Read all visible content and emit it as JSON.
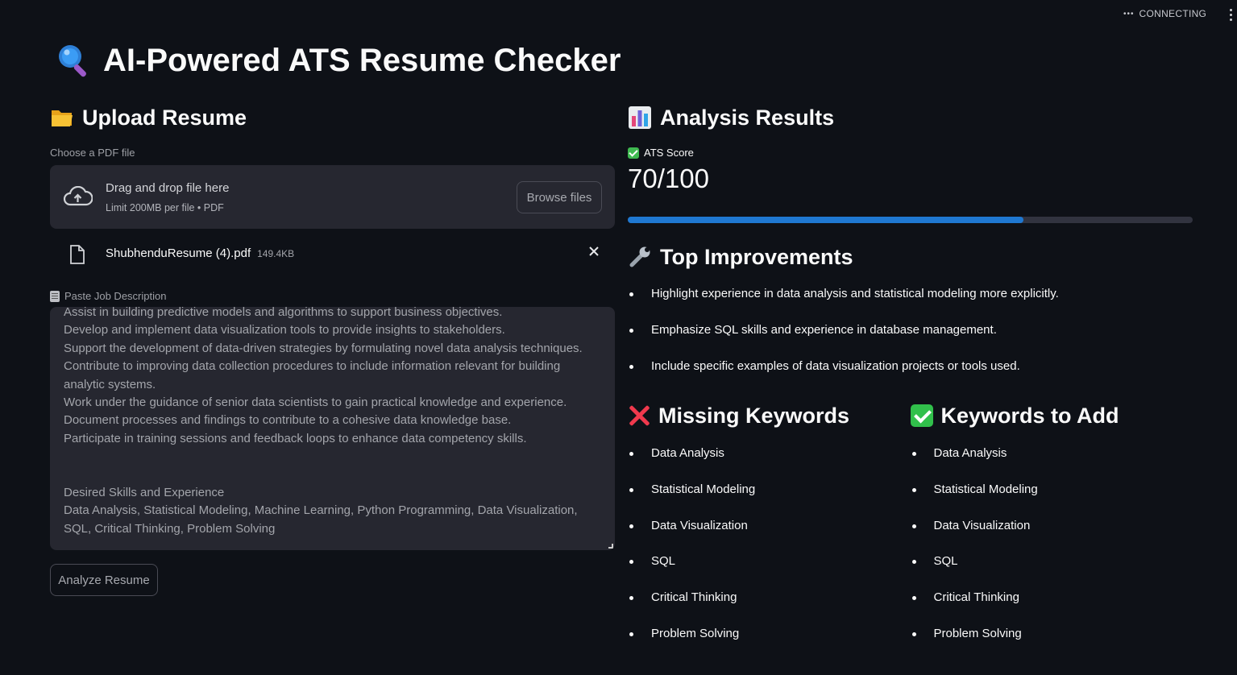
{
  "status": {
    "dots": "•••",
    "label": "CONNECTING"
  },
  "header": {
    "title": "AI-Powered ATS Resume Checker",
    "icon": "magnifier-icon"
  },
  "upload": {
    "heading": "Upload Resume",
    "heading_icon": "folder-icon",
    "field_label": "Choose a PDF file",
    "drop_text": "Drag and drop file here",
    "limit_text": "Limit 200MB per file • PDF",
    "browse_label": "Browse files",
    "file": {
      "name": "ShubhenduResume (4).pdf",
      "size": "149.4KB"
    }
  },
  "job_description": {
    "label": "Paste Job Description",
    "text": "Assist in building predictive models and algorithms to support business objectives.\nDevelop and implement data visualization tools to provide insights to stakeholders.\nSupport the development of data-driven strategies by formulating novel data analysis techniques.\nContribute to improving data collection procedures to include information relevant for building analytic systems.\nWork under the guidance of senior data scientists to gain practical knowledge and experience.\nDocument processes and findings to contribute to a cohesive data knowledge base.\nParticipate in training sessions and feedback loops to enhance data competency skills.\n\n\nDesired Skills and Experience\nData Analysis, Statistical Modeling, Machine Learning, Python Programming, Data Visualization, SQL, Critical Thinking, Problem Solving"
  },
  "analyze_button": "Analyze Resume",
  "results": {
    "heading": "Analysis Results",
    "heading_icon": "bar-chart-icon",
    "score_label": "ATS Score",
    "score_value": "70/100",
    "score_fraction": 0.7,
    "improvements_heading": "Top Improvements",
    "improvements": [
      "Highlight experience in data analysis and statistical modeling more explicitly.",
      "Emphasize SQL skills and experience in database management.",
      "Include specific examples of data visualization projects or tools used."
    ],
    "missing_heading": "Missing Keywords",
    "missing": [
      "Data Analysis",
      "Statistical Modeling",
      "Data Visualization",
      "SQL",
      "Critical Thinking",
      "Problem Solving"
    ],
    "add_heading": "Keywords to Add",
    "add": [
      "Data Analysis",
      "Statistical Modeling",
      "Data Visualization",
      "SQL",
      "Critical Thinking",
      "Problem Solving"
    ]
  },
  "colors": {
    "background": "#0e1117",
    "panel": "#262730",
    "progress": "#1f78d1",
    "danger": "#f0394d",
    "success": "#31c04b"
  }
}
